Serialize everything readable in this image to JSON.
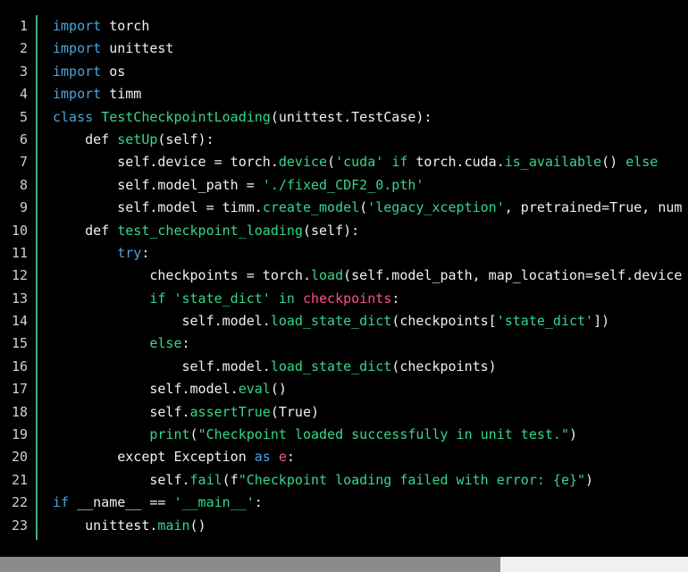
{
  "editor": {
    "line_numbers": [
      "1",
      "2",
      "3",
      "4",
      "5",
      "6",
      "7",
      "8",
      "9",
      "10",
      "11",
      "12",
      "13",
      "14",
      "15",
      "16",
      "17",
      "18",
      "19",
      "20",
      "21",
      "22",
      "23"
    ],
    "lines": [
      [
        {
          "t": "import",
          "c": "kw"
        },
        {
          "t": " torch",
          "c": "p"
        }
      ],
      [
        {
          "t": "import",
          "c": "kw"
        },
        {
          "t": " unittest",
          "c": "p"
        }
      ],
      [
        {
          "t": "import",
          "c": "kw"
        },
        {
          "t": " os",
          "c": "p"
        }
      ],
      [
        {
          "t": "import",
          "c": "kw"
        },
        {
          "t": " timm",
          "c": "p"
        }
      ],
      [
        {
          "t": "class",
          "c": "kw"
        },
        {
          "t": " ",
          "c": "p"
        },
        {
          "t": "TestCheckpointLoading",
          "c": "fn"
        },
        {
          "t": "(unittest.TestCase):",
          "c": "p"
        }
      ],
      [
        {
          "t": "    ",
          "c": "p"
        },
        {
          "t": "def",
          "c": "p"
        },
        {
          "t": " ",
          "c": "p"
        },
        {
          "t": "setUp",
          "c": "fn"
        },
        {
          "t": "(self):",
          "c": "p"
        }
      ],
      [
        {
          "t": "        self.device = torch.",
          "c": "p"
        },
        {
          "t": "device",
          "c": "fn"
        },
        {
          "t": "(",
          "c": "p"
        },
        {
          "t": "'cuda'",
          "c": "str"
        },
        {
          "t": " ",
          "c": "p"
        },
        {
          "t": "if",
          "c": "fn"
        },
        {
          "t": " torch.cuda.",
          "c": "p"
        },
        {
          "t": "is_available",
          "c": "fn"
        },
        {
          "t": "() ",
          "c": "p"
        },
        {
          "t": "else",
          "c": "fn"
        }
      ],
      [
        {
          "t": "        self.model_path = ",
          "c": "p"
        },
        {
          "t": "'./fixed_CDF2_0.pth'",
          "c": "str"
        }
      ],
      [
        {
          "t": "        self.model = timm.",
          "c": "p"
        },
        {
          "t": "create_model",
          "c": "fn"
        },
        {
          "t": "(",
          "c": "p"
        },
        {
          "t": "'legacy_xception'",
          "c": "str"
        },
        {
          "t": ", pretrained=True, num",
          "c": "p"
        }
      ],
      [
        {
          "t": "    ",
          "c": "p"
        },
        {
          "t": "def",
          "c": "p"
        },
        {
          "t": " ",
          "c": "p"
        },
        {
          "t": "test_checkpoint_loading",
          "c": "fn"
        },
        {
          "t": "(self):",
          "c": "p"
        }
      ],
      [
        {
          "t": "        ",
          "c": "p"
        },
        {
          "t": "try",
          "c": "kw"
        },
        {
          "t": ":",
          "c": "p"
        }
      ],
      [
        {
          "t": "            checkpoints = torch.",
          "c": "p"
        },
        {
          "t": "load",
          "c": "fn"
        },
        {
          "t": "(self.model_path, map_location=self.device",
          "c": "p"
        }
      ],
      [
        {
          "t": "            ",
          "c": "p"
        },
        {
          "t": "if",
          "c": "fn"
        },
        {
          "t": " ",
          "c": "p"
        },
        {
          "t": "'state_dict'",
          "c": "str"
        },
        {
          "t": " ",
          "c": "p"
        },
        {
          "t": "in",
          "c": "fn"
        },
        {
          "t": " ",
          "c": "p"
        },
        {
          "t": "checkpoints",
          "c": "name"
        },
        {
          "t": ":",
          "c": "p"
        }
      ],
      [
        {
          "t": "                self.model.",
          "c": "p"
        },
        {
          "t": "load_state_dict",
          "c": "fn"
        },
        {
          "t": "(checkpoints[",
          "c": "p"
        },
        {
          "t": "'state_dict'",
          "c": "str"
        },
        {
          "t": "])",
          "c": "p"
        }
      ],
      [
        {
          "t": "            ",
          "c": "p"
        },
        {
          "t": "else",
          "c": "fn"
        },
        {
          "t": ":",
          "c": "p"
        }
      ],
      [
        {
          "t": "                self.model.",
          "c": "p"
        },
        {
          "t": "load_state_dict",
          "c": "fn"
        },
        {
          "t": "(checkpoints)",
          "c": "p"
        }
      ],
      [
        {
          "t": "            self.model.",
          "c": "p"
        },
        {
          "t": "eval",
          "c": "fn"
        },
        {
          "t": "()",
          "c": "p"
        }
      ],
      [
        {
          "t": "            self.",
          "c": "p"
        },
        {
          "t": "assertTrue",
          "c": "fn"
        },
        {
          "t": "(True)",
          "c": "p"
        }
      ],
      [
        {
          "t": "            ",
          "c": "p"
        },
        {
          "t": "print",
          "c": "fn"
        },
        {
          "t": "(",
          "c": "p"
        },
        {
          "t": "\"Checkpoint loaded successfully in unit test.\"",
          "c": "str"
        },
        {
          "t": ")",
          "c": "p"
        }
      ],
      [
        {
          "t": "        except Exception ",
          "c": "p"
        },
        {
          "t": "as",
          "c": "kw"
        },
        {
          "t": " ",
          "c": "p"
        },
        {
          "t": "e",
          "c": "name"
        },
        {
          "t": ":",
          "c": "p"
        }
      ],
      [
        {
          "t": "            self.",
          "c": "p"
        },
        {
          "t": "fail",
          "c": "fn"
        },
        {
          "t": "(f",
          "c": "p"
        },
        {
          "t": "\"Checkpoint loading failed with error: {e}\"",
          "c": "str"
        },
        {
          "t": ")",
          "c": "p"
        }
      ],
      [
        {
          "t": "if",
          "c": "kw"
        },
        {
          "t": " __name__ == ",
          "c": "p"
        },
        {
          "t": "'__main__'",
          "c": "str"
        },
        {
          "t": ":",
          "c": "p"
        }
      ],
      [
        {
          "t": "    unittest.",
          "c": "p"
        },
        {
          "t": "main",
          "c": "fn"
        },
        {
          "t": "()",
          "c": "p"
        }
      ]
    ]
  },
  "colors": {
    "background": "#000000",
    "keyword": "#4aa3df",
    "function": "#36d68b",
    "string": "#36d68b",
    "name": "#ff4f87",
    "gutter_border": "#3fae8a"
  }
}
